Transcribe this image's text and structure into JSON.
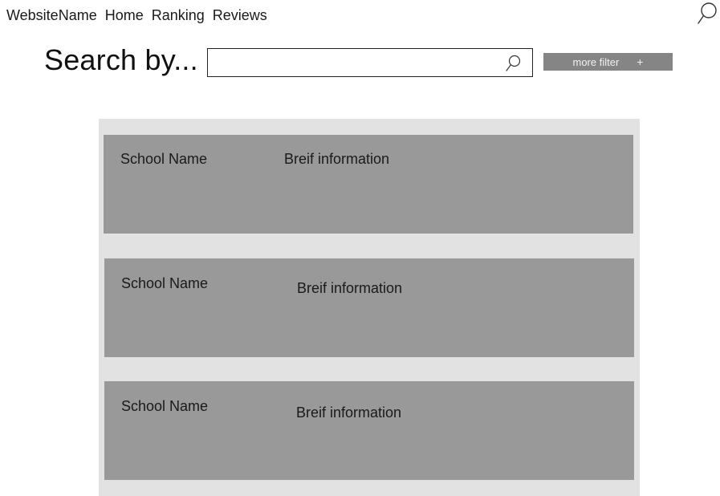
{
  "nav": {
    "brand": "WebsiteName",
    "links": [
      "Home",
      "Ranking",
      "Reviews"
    ]
  },
  "header": {
    "search_icon": "search-icon"
  },
  "search": {
    "label": "Search by...",
    "value": "",
    "placeholder": "",
    "icon": "search-icon"
  },
  "filter": {
    "label": "more filter",
    "plus": "+"
  },
  "results": [
    {
      "name": "School Name",
      "info": "Breif information"
    },
    {
      "name": "School Name",
      "info": "Breif information"
    },
    {
      "name": "School Name",
      "info": "Breif information"
    }
  ],
  "colors": {
    "panel": "#e2e2e2",
    "card": "#999999",
    "button": "#858585"
  }
}
